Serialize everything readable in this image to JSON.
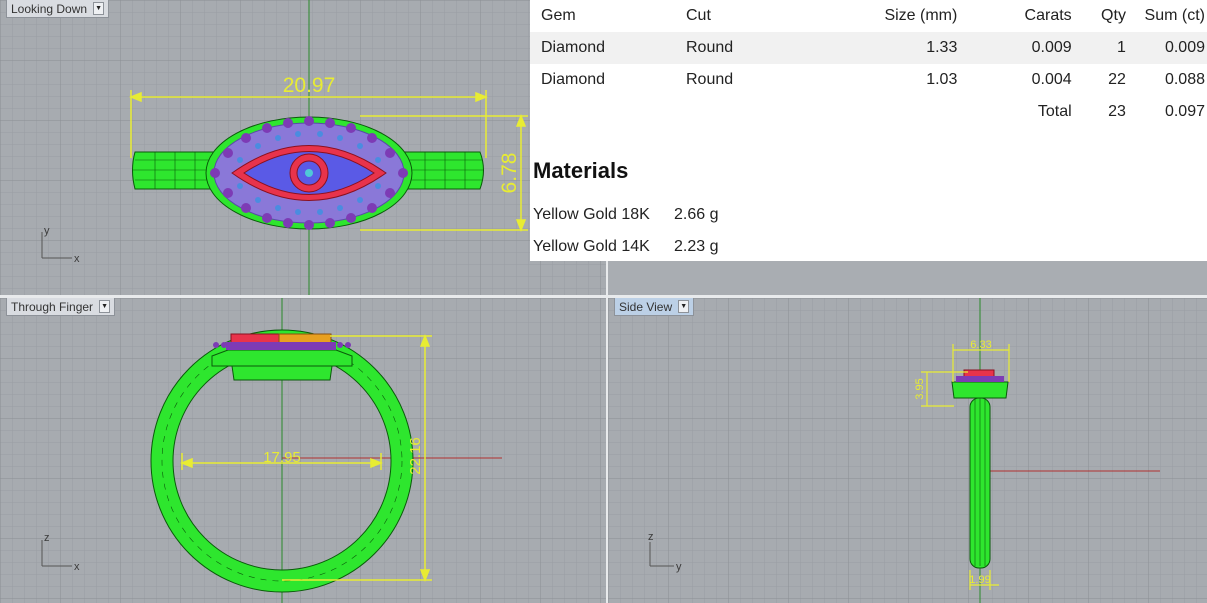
{
  "viewports": {
    "top": {
      "label": "Looking Down",
      "dimensions": {
        "width": "20.97",
        "height": "6.78"
      },
      "axes": {
        "vertical": "y",
        "horizontal": "x"
      }
    },
    "front": {
      "label": "Through Finger",
      "dimensions": {
        "inner": "17.95",
        "height": "22.16"
      },
      "axes": {
        "vertical": "z",
        "horizontal": "x"
      }
    },
    "side": {
      "label": "Side View",
      "dimensions": {
        "top_width": "6.33",
        "head_height": "3.95",
        "band_width": "1.99"
      },
      "axes": {
        "vertical": "z",
        "horizontal": "y"
      }
    }
  },
  "gem_table": {
    "headers": [
      "Gem",
      "Cut",
      "Size (mm)",
      "Carats",
      "Qty",
      "Sum (ct)"
    ],
    "rows": [
      [
        "Diamond",
        "Round",
        "1.33",
        "0.009",
        "1",
        "0.009"
      ],
      [
        "Diamond",
        "Round",
        "1.03",
        "0.004",
        "22",
        "0.088"
      ]
    ],
    "total": {
      "label": "Total",
      "qty": "23",
      "sum": "0.097"
    }
  },
  "materials": {
    "heading": "Materials",
    "items": [
      {
        "name": "Yellow Gold 18K",
        "weight": "2.66 g"
      },
      {
        "name": "Yellow Gold 14K",
        "weight": "2.23 g"
      }
    ]
  },
  "colors": {
    "band": "#2ee62e",
    "stone_rim": "#e8334b",
    "stone_center": "#5a5ae6",
    "pave": "#7d3bb5",
    "dimension": "#e8ec33"
  }
}
